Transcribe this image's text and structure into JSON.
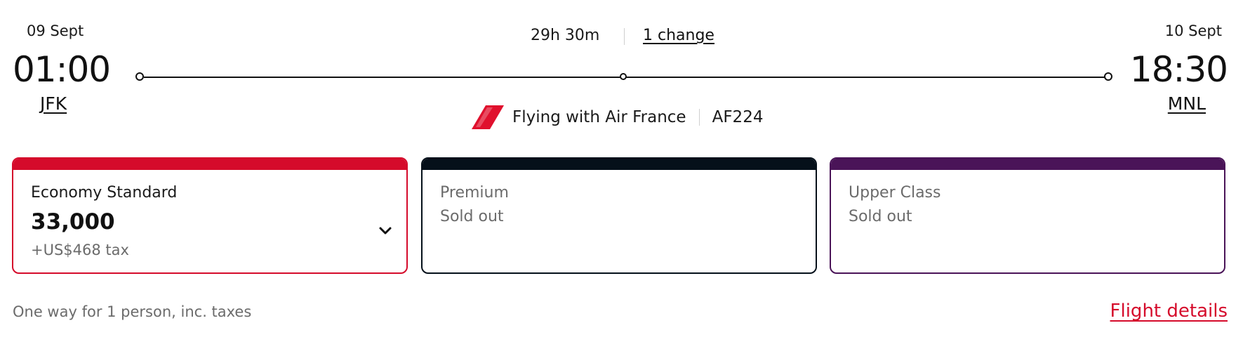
{
  "flight": {
    "departure": {
      "date": "09 Sept",
      "time": "01:00",
      "airport": "JFK"
    },
    "arrival": {
      "date": "10 Sept",
      "time": "18:30",
      "airport": "MNL"
    },
    "duration": "29h 30m",
    "changes": "1 change",
    "operator": "Flying with Air France",
    "flight_number": "AF224"
  },
  "fares": [
    {
      "cabin": "Economy Standard",
      "price": "33,000",
      "tax": "+US$468 tax",
      "color": "#d50b2b"
    },
    {
      "cabin": "Premium",
      "status": "Sold out",
      "color": "#05101a"
    },
    {
      "cabin": "Upper Class",
      "status": "Sold out",
      "color": "#4a1458"
    }
  ],
  "footer": {
    "note": "One way for 1 person, inc. taxes",
    "details_link": "Flight details"
  },
  "icons": {
    "airline_logo": "air-france-logo",
    "expand": "chevron-down-icon"
  },
  "colors": {
    "accent": "#d50b2b",
    "logo": "#e0102d"
  }
}
